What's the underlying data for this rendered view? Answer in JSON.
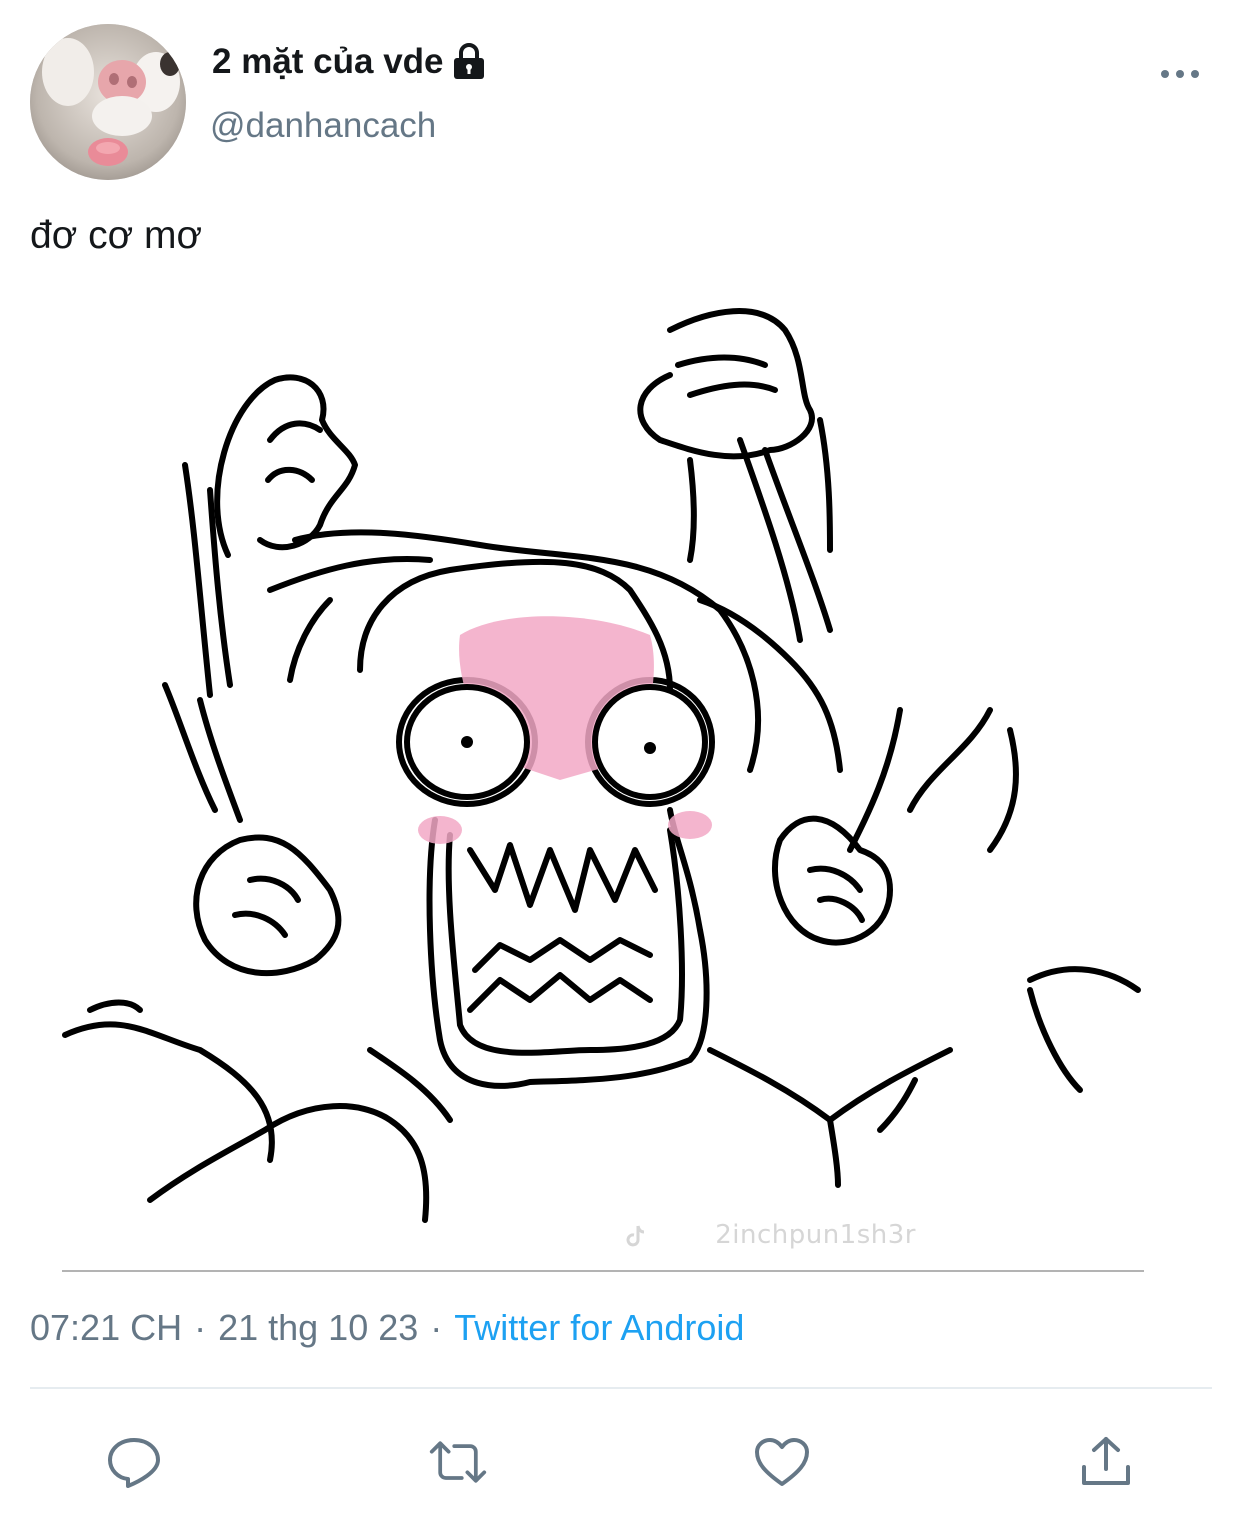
{
  "tweet": {
    "author": {
      "display_name": "2 mặt của vde",
      "handle": "@danhancach",
      "protected_icon": "lock-icon",
      "avatar": "hamster-face-avatar"
    },
    "text": "đơ cơ mơ",
    "media": {
      "watermark": "2inchpun1sh3r",
      "watermark_icon": "tiktok-icon"
    },
    "meta": {
      "time": "07:21 CH",
      "separator": "·",
      "date": "21 thg 10 23",
      "source": "Twitter for Android"
    },
    "more_icon": "more-horizontal-icon",
    "actions": [
      {
        "icon": "reply-icon"
      },
      {
        "icon": "retweet-icon"
      },
      {
        "icon": "like-icon"
      },
      {
        "icon": "share-icon"
      }
    ]
  },
  "colors": {
    "text": "#14171a",
    "secondary": "#657786",
    "link": "#1da1f2",
    "divider": "#e6ecf0",
    "blush": "#f2a8c6"
  }
}
